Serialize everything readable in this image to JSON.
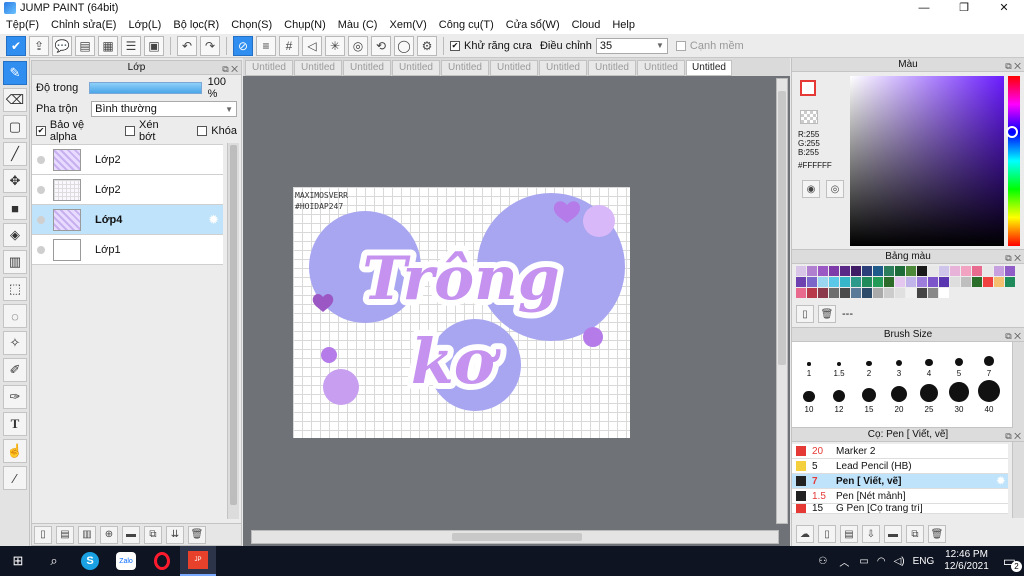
{
  "window": {
    "title": "JUMP PAINT (64bit)",
    "min": "—",
    "max": "❐",
    "close": "✕"
  },
  "menu": [
    "Tệp(F)",
    "Chỉnh sửa(E)",
    "Lớp(L)",
    "Bộ lọc(R)",
    "Chọn(S)",
    "Chụp(N)",
    "Màu (C)",
    "Xem(V)",
    "Công cụ(T)",
    "Cửa sổ(W)",
    "Cloud",
    "Help"
  ],
  "toolbar": {
    "antialias_label": "Khử răng cưa",
    "adjust_label": "Điều chỉnh",
    "adjust_value": "35",
    "snap_label": "Cạnh mềm"
  },
  "layer_panel": {
    "title": "Lớp",
    "opacity_label": "Độ trong",
    "opacity_value": "100 %",
    "opacity_fraction": 1.0,
    "blend_label": "Pha trộn",
    "blend_value": "Bình thường",
    "protect_alpha": "Bảo vệ alpha",
    "clip": "Xén bớt",
    "lock": "Khóa",
    "layers": [
      {
        "name": "Lớp2",
        "thumb": "purple"
      },
      {
        "name": "Lớp2",
        "thumb": "grid"
      },
      {
        "name": "Lớp4",
        "thumb": "purple",
        "selected": true
      },
      {
        "name": "Lớp1",
        "thumb": "blank"
      }
    ]
  },
  "tabs": [
    "Untitled",
    "Untitled",
    "Untitled",
    "Untitled",
    "Untitled",
    "Untitled",
    "Untitled",
    "Untitled",
    "Untitled",
    "Untitled"
  ],
  "artwork": {
    "line1": "Trông",
    "line2": "kơ",
    "watermark1": "MAXIMOSVERR",
    "watermark2": "#HOIDAP247"
  },
  "color_panel": {
    "title": "Màu",
    "r": "R:255",
    "g": "G:255",
    "b": "B:255",
    "hex": "#FFFFFF"
  },
  "palette_panel": {
    "title": "Bảng màu",
    "dash": "---",
    "colors": [
      "#d9c5e8",
      "#b07fd0",
      "#9b57c4",
      "#7d3aa8",
      "#5a2886",
      "#3f1b66",
      "#2a3e7a",
      "#1e5b8a",
      "#2b7d5b",
      "#1e6b3a",
      "#4c8a3a",
      "#1a1a1a",
      "#e8e8e8",
      "#cfc5ea",
      "#e8b3d9",
      "#f2a3c2",
      "#e86a8e",
      "#e8e8e8",
      "#c7a0e0",
      "#8f5cc8",
      "#6e41b0",
      "#7b66c9",
      "#9ad6f0",
      "#5cc8e8",
      "#38b6c9",
      "#2c9a8a",
      "#1f8a5a",
      "#239a55",
      "#2d6b2a",
      "#e3c7ef",
      "#c0b4ea",
      "#9d7edc",
      "#7b55c9",
      "#5a36b0",
      "#dedede",
      "#bfbfbf",
      "#2a6e2a",
      "#f04040",
      "#f4c070",
      "#1f8a5a",
      "#e86a8e",
      "#b83a4a",
      "#8a3a4a",
      "#6e6e6e",
      "#4a4a4a",
      "#5a7a9a",
      "#2c4a6a",
      "#aaaaaa",
      "#cccccc",
      "#e0e0e0",
      "#f0f0f0",
      "#444444",
      "#888888",
      "#ffffff"
    ]
  },
  "brush_size_panel": {
    "title": "Brush Size",
    "sizes": [
      "1",
      "1.5",
      "2",
      "3",
      "4",
      "5",
      "7",
      "10",
      "12",
      "15",
      "20",
      "25",
      "30",
      "40"
    ]
  },
  "brush_panel": {
    "title": "Cọ: Pen [ Viết, vẽ]",
    "brushes": [
      {
        "size": "20",
        "name": "Marker 2",
        "color": "#e53935"
      },
      {
        "size": "5",
        "name": "Lead Pencil (HB)",
        "color": "#f4d03f"
      },
      {
        "size": "7",
        "name": "Pen [ Viết, vẽ]",
        "color": "#222222",
        "selected": true
      },
      {
        "size": "1.5",
        "name": "Pen [Nét mảnh]",
        "color": "#222222"
      },
      {
        "size": "15",
        "name": "G Pen [Cọ trang trí]",
        "color": "#e53935"
      }
    ]
  },
  "taskbar": {
    "lang": "ENG",
    "time": "12:46 PM",
    "date": "12/6/2021",
    "badge": "2"
  }
}
